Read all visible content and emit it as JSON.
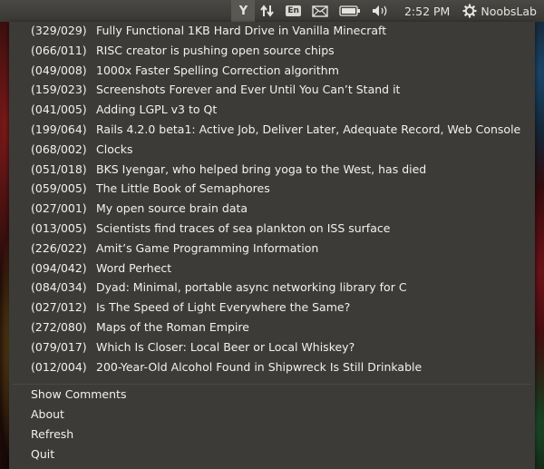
{
  "panel": {
    "indicator_letter": "Y",
    "keyboard_layout": "En",
    "clock": "2:52 PM",
    "user_name": "NoobsLab"
  },
  "menu": {
    "stories": [
      {
        "count": "(329/029)",
        "title": "Fully Functional 1KB Hard Drive in Vanilla Minecraft"
      },
      {
        "count": "(066/011)",
        "title": "RISC creator is pushing open source chips"
      },
      {
        "count": "(049/008)",
        "title": "1000x Faster Spelling Correction algorithm"
      },
      {
        "count": "(159/023)",
        "title": "Screenshots Forever and Ever Until You Can’t Stand it"
      },
      {
        "count": "(041/005)",
        "title": "Adding LGPL v3 to Qt"
      },
      {
        "count": "(199/064)",
        "title": "Rails 4.2.0 beta1: Active Job, Deliver Later, Adequate Record, Web Console"
      },
      {
        "count": "(068/002)",
        "title": "Clocks"
      },
      {
        "count": "(051/018)",
        "title": "BKS Iyengar, who helped bring yoga to the West, has died"
      },
      {
        "count": "(059/005)",
        "title": "The Little Book of Semaphores"
      },
      {
        "count": "(027/001)",
        "title": "My open source brain data"
      },
      {
        "count": "(013/005)",
        "title": "Scientists find traces of sea plankton on ISS surface"
      },
      {
        "count": "(226/022)",
        "title": "Amit’s Game Programming Information"
      },
      {
        "count": "(094/042)",
        "title": "Word Perhect"
      },
      {
        "count": "(084/034)",
        "title": "Dyad: Minimal, portable async networking library for C"
      },
      {
        "count": "(027/012)",
        "title": "Is The Speed of Light Everywhere the Same?"
      },
      {
        "count": "(272/080)",
        "title": "Maps of the Roman Empire"
      },
      {
        "count": "(079/017)",
        "title": "Which Is Closer: Local Beer or Local Whiskey?"
      },
      {
        "count": "(012/004)",
        "title": "200-Year-Old Alcohol Found in Shipwreck Is Still Drinkable"
      }
    ],
    "actions": {
      "show_comments": "Show Comments",
      "about": "About",
      "refresh": "Refresh",
      "quit": "Quit"
    }
  },
  "icons": {
    "indicator": "hacker-news-y-icon",
    "network": "network-arrows-icon",
    "keyboard": "keyboard-layout-icon",
    "mail": "mail-envelope-icon",
    "battery": "battery-icon",
    "volume": "speaker-volume-icon",
    "session": "gear-icon"
  },
  "colors": {
    "panel_bg": "#3c3b37",
    "menu_bg": "#3c3b37",
    "text": "#f2f1ee",
    "active_indicator": "#5a5853"
  }
}
